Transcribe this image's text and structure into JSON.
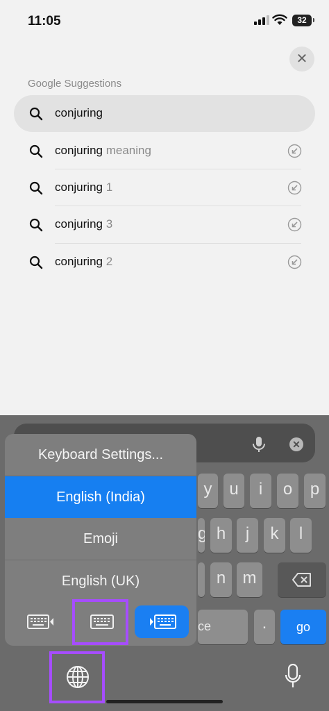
{
  "status_bar": {
    "time": "11:05",
    "battery": "32"
  },
  "search": {
    "section_title": "Google Suggestions",
    "suggestions": [
      {
        "main": "conjuring",
        "rest": ""
      },
      {
        "main": "conjuring",
        "rest": " meaning"
      },
      {
        "main": "conjuring",
        "rest": " 1"
      },
      {
        "main": "conjuring",
        "rest": " 3"
      },
      {
        "main": "conjuring",
        "rest": " 2"
      }
    ]
  },
  "keyboard": {
    "keys_row1": [
      "y",
      "u",
      "i",
      "o",
      "p"
    ],
    "keys_row2": [
      "g",
      "h",
      "j",
      "k",
      "l"
    ],
    "keys_row3": [
      "n",
      "m"
    ],
    "space_fragment": "ce",
    "go_label": "go"
  },
  "keyboard_menu": {
    "items": [
      "Keyboard Settings...",
      "English (India)",
      "Emoji",
      "English (UK)"
    ],
    "selected_index": 1,
    "layout_options": [
      "left-keyboard-icon",
      "full-keyboard-icon",
      "right-keyboard-icon"
    ],
    "selected_layout": "right-keyboard-icon"
  },
  "colors": {
    "accent_blue": "#1a7ff2",
    "highlight_purple": "#a64dff"
  }
}
